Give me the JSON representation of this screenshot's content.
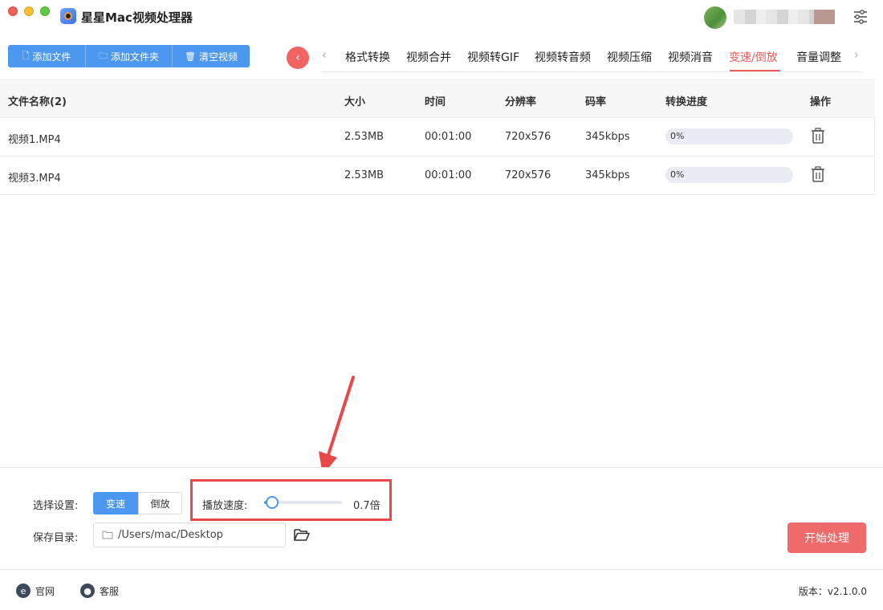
{
  "app": {
    "title": "星星Mac视频处理器"
  },
  "toolbar": {
    "add_file": "添加文件",
    "add_folder": "添加文件夹",
    "clear_videos": "清空视频"
  },
  "tabs": [
    {
      "label": "格式转换"
    },
    {
      "label": "视频合并"
    },
    {
      "label": "视频转GIF"
    },
    {
      "label": "视频转音频"
    },
    {
      "label": "视频压缩"
    },
    {
      "label": "视频消音"
    },
    {
      "label": "变速/倒放",
      "active": true
    },
    {
      "label": "音量调整"
    }
  ],
  "table": {
    "headers": {
      "name": "文件名称(2)",
      "size": "大小",
      "time": "时间",
      "resolution": "分辨率",
      "bitrate": "码率",
      "progress": "转换进度",
      "action": "操作"
    },
    "rows": [
      {
        "name": "视频1.MP4",
        "size": "2.53MB",
        "time": "00:01:00",
        "resolution": "720x576",
        "bitrate": "345kbps",
        "progress": "0%"
      },
      {
        "name": "视频3.MP4",
        "size": "2.53MB",
        "time": "00:01:00",
        "resolution": "720x576",
        "bitrate": "345kbps",
        "progress": "0%"
      }
    ]
  },
  "settings": {
    "select_label": "选择设置:",
    "mode_speed": "变速",
    "mode_reverse": "倒放",
    "speed_label": "播放速度:",
    "speed_value": "0.7倍",
    "speed_slider_fraction": 0.1,
    "save_label": "保存目录:",
    "save_path": "/Users/mac/Desktop"
  },
  "actions": {
    "start": "开始处理"
  },
  "footer": {
    "website": "官网",
    "support": "客服",
    "version": "版本：v2.1.0.0"
  },
  "colors": {
    "accent_blue": "#4c97f0",
    "accent_red": "#f05a5a",
    "highlight_red": "#e84848"
  },
  "icons": {
    "settings": "sliders-icon",
    "file": "document-icon",
    "folder": "folder-icon",
    "trash": "trash-icon",
    "folder_open": "folder-open-icon",
    "website": "browser-icon",
    "support": "chat-bubble-icon"
  }
}
